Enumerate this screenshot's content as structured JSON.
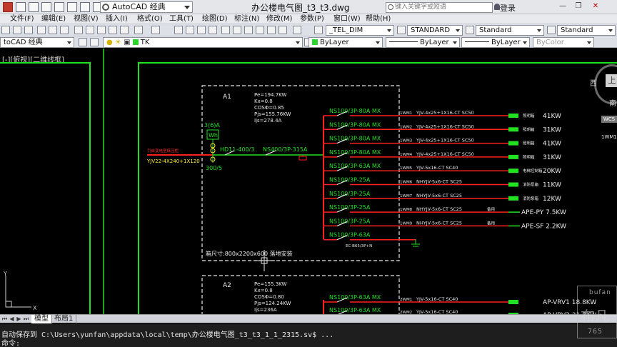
{
  "window": {
    "title": "办公楼电气图_t3_t3.dwg",
    "workspace": "AutoCAD 经典",
    "search_placeholder": "键入关键字或短语",
    "login_label": "登录",
    "win_controls": [
      "—",
      "❐",
      "✕"
    ]
  },
  "menu": [
    "文件(F)",
    "编辑(E)",
    "视图(V)",
    "插入(I)",
    "格式(O)",
    "工具(T)",
    "绘图(D)",
    "标注(N)",
    "修改(M)",
    "参数(P)",
    "窗口(W)",
    "帮助(H)"
  ],
  "toolbar": {
    "text_style": "_TEL_DIM",
    "dim_style": "STANDARD",
    "table_style": "Standard",
    "mleader_style": "Standard",
    "workspace_combo": "toCAD 经典",
    "layer": "TK",
    "color": "ByLayer",
    "linetype": "ByLayer",
    "lineweight": "ByLayer",
    "plotstyle": "ByColor"
  },
  "viewport": {
    "label": "[-][俯视][二维线框]",
    "viewcube": {
      "face": "上",
      "west": "西",
      "south": "南",
      "wcs": "WCS"
    }
  },
  "tabs": [
    "模型",
    "布局1"
  ],
  "command": {
    "line1": "自动保存到 C:\\Users\\yunfan\\appdata\\local\\temp\\办公楼电气图_t3_t3_1_1_2315.sv$ ...",
    "line2": "命令:"
  },
  "watermark": {
    "brand": "bufan",
    "text": "布凡",
    "num": "765"
  },
  "drawing": {
    "panel1": {
      "name": "A1",
      "params": [
        "Pe=194.7KW",
        "Kx=0.8",
        "COSΦ=0.85",
        "Pjs=155.76KW",
        "Ijs=278.4A"
      ],
      "incoming_label": "引自变电室低压柜",
      "incoming_cable": "YJV22-4X240+1X120",
      "ct": "3(6)A",
      "meter": "Wh",
      "ct_ratio": "300/5",
      "isolator": "HD11-400/3",
      "main_breaker": "NS400/3P-315A",
      "size_note": "箱尺寸:800x2200x600 落地安装",
      "spare_breaker": "EC-B65/3P+N",
      "circuits": [
        {
          "breaker": "NS100/3P-80A MX",
          "id": "1WM1",
          "cable": "YJV-4x25+1X16-CT SC50",
          "label": "照明箱",
          "load": "41KW"
        },
        {
          "breaker": "NS100/3P-80A MX",
          "id": "1WM2",
          "cable": "YJV-4x25+1X16-CT SC50",
          "label": "照明箱",
          "load": "31KW"
        },
        {
          "breaker": "NS100/3P-80A MX",
          "id": "1WM3",
          "cable": "YJV-4x25+1X16-CT SC50",
          "label": "照明箱",
          "load": "41KW"
        },
        {
          "breaker": "NS100/3P-80A MX",
          "id": "1WM4",
          "cable": "YJV-4x25+1X16-CT SC50",
          "label": "照明箱",
          "load": "31KW"
        },
        {
          "breaker": "NS100/3P-63A MX",
          "id": "1WM5",
          "cable": "YJV-5x16-CT SC40",
          "label": "电梯控制箱",
          "load": "20KW"
        },
        {
          "breaker": "NS100/3P-25A",
          "id": "1WM6",
          "cable": "NHYJV-5x6-CT SC25",
          "label": "消防泵箱",
          "load": "11KW"
        },
        {
          "breaker": "NS100/3P-25A",
          "id": "1WM7",
          "cable": "NHYJV-5x6-CT SC25",
          "label": "消防泵箱",
          "load": "12KW"
        },
        {
          "breaker": "NS100/3P-25A",
          "id": "1WM8",
          "cable": "NHYJV-5x6-CT SC25",
          "label": "备用",
          "load": "APE-PY 7.5KW"
        },
        {
          "breaker": "NS100/3P-25A",
          "id": "1WM9",
          "cable": "NHYJV-5x6-CT SC25",
          "label": "备用",
          "load": "APE-SF 2.2KW"
        },
        {
          "breaker": "NS100/3P-63A",
          "id": "",
          "cable": "",
          "label": "",
          "load": ""
        }
      ]
    },
    "panel2": {
      "name": "A2",
      "params": [
        "Pe=155.3KW",
        "Kx=0.8",
        "COSΦ=0.80",
        "Pjs=124.24KW",
        "Ijs=236A"
      ],
      "circuits": [
        {
          "breaker": "NS100/3P-63A MX",
          "id": "2WM1",
          "cable": "YJV-5x16-CT SC40",
          "load": "AP-VRV1 18.8KW"
        },
        {
          "breaker": "NS100/3P-63A MX",
          "id": "2WM2",
          "cable": "YJV-5x16-CT SC40",
          "load": "AP-VRV2 21.8KW"
        }
      ]
    },
    "right_edge_label": "1WM1"
  },
  "colors": {
    "green": "#22e022",
    "red": "#ff2020",
    "yellow": "#ffee33",
    "white": "#e8e8e8",
    "cyan": "#22d0d0"
  }
}
